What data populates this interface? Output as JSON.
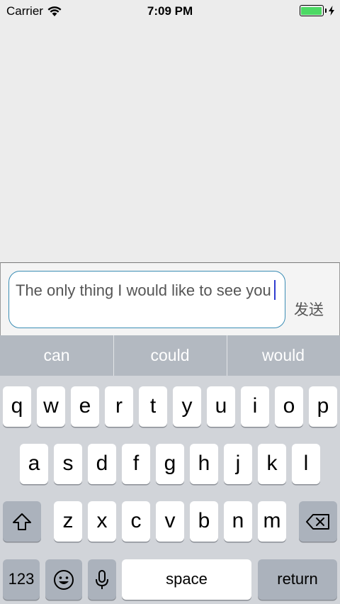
{
  "status_bar": {
    "carrier": "Carrier",
    "time": "7:09 PM",
    "battery_color": "#4cd964"
  },
  "input": {
    "text": "The only thing I would like to see you",
    "send_label": "发送",
    "border_color": "#3b8db4",
    "caret_color": "#2f3ccf"
  },
  "keyboard": {
    "suggestions": [
      "can",
      "could",
      "would"
    ],
    "row1": [
      "q",
      "w",
      "e",
      "r",
      "t",
      "y",
      "u",
      "i",
      "o",
      "p"
    ],
    "row2": [
      "a",
      "s",
      "d",
      "f",
      "g",
      "h",
      "j",
      "k",
      "l"
    ],
    "row3": [
      "z",
      "x",
      "c",
      "v",
      "b",
      "n",
      "m"
    ],
    "numbers_label": "123",
    "space_label": "space",
    "return_label": "return",
    "icons": {
      "shift": "shift-icon",
      "delete": "delete-icon",
      "emoji": "emoji-icon",
      "mic": "microphone-icon"
    }
  }
}
